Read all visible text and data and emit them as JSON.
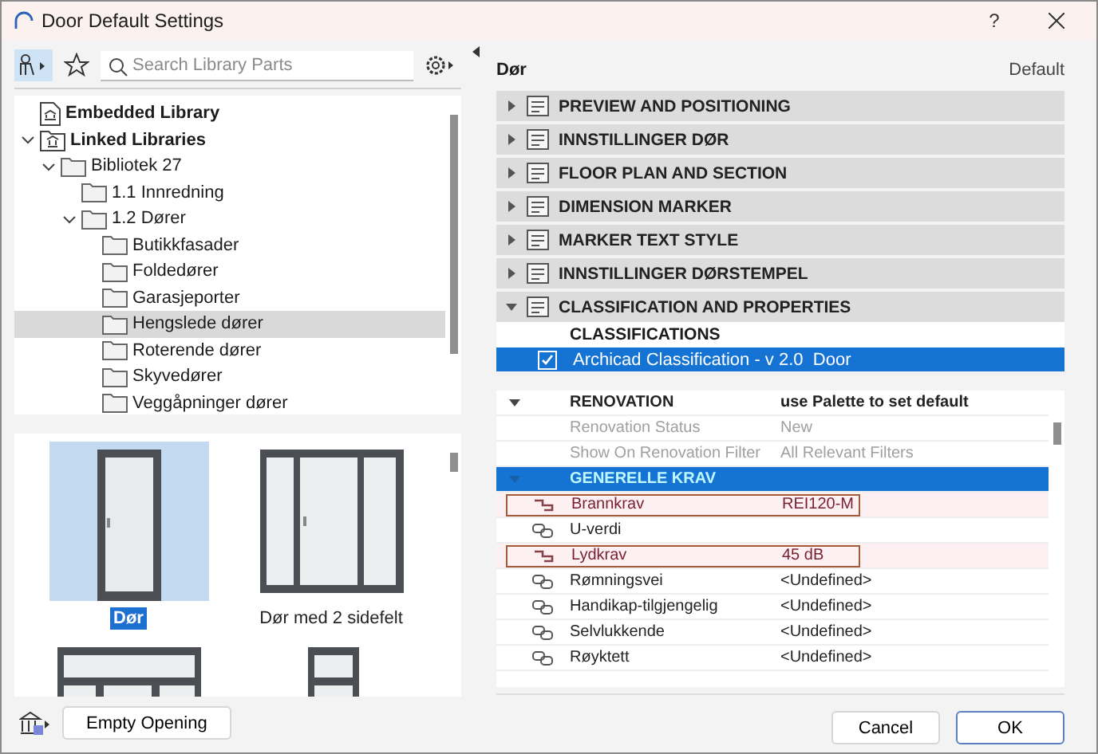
{
  "window": {
    "title": "Door Default Settings",
    "help": "?"
  },
  "library": {
    "search": {
      "placeholder": "Search Library Parts"
    },
    "tree": [
      {
        "label": "Embedded Library",
        "kind": "embedded",
        "bold": true,
        "selected": false
      },
      {
        "label": "Linked Libraries",
        "kind": "library",
        "bold": true,
        "expanded": true,
        "selected": false,
        "children": [
          {
            "label": "Bibliotek 27",
            "kind": "folder",
            "bold": false,
            "expanded": true,
            "selected": false,
            "children": [
              {
                "label": "1.1 Innredning",
                "kind": "folder",
                "bold": false,
                "selected": false
              },
              {
                "label": "1.2 Dører",
                "kind": "folder",
                "bold": false,
                "expanded": true,
                "selected": false,
                "children": [
                  {
                    "label": "Butikkfasader",
                    "kind": "folder",
                    "bold": false,
                    "selected": false
                  },
                  {
                    "label": "Foldedører",
                    "kind": "folder",
                    "bold": false,
                    "selected": false
                  },
                  {
                    "label": "Garasjeporter",
                    "kind": "folder",
                    "bold": false,
                    "selected": false
                  },
                  {
                    "label": "Hengslede dører",
                    "kind": "folder",
                    "bold": false,
                    "selected": true
                  },
                  {
                    "label": "Roterende dører",
                    "kind": "folder",
                    "bold": false,
                    "selected": false
                  },
                  {
                    "label": "Skyvedører",
                    "kind": "folder",
                    "bold": false,
                    "selected": false
                  },
                  {
                    "label": "Veggåpninger dører",
                    "kind": "folder",
                    "bold": false,
                    "selected": false
                  }
                ]
              }
            ]
          }
        ]
      }
    ],
    "thumbnails": [
      {
        "label": "Dør",
        "kind": "single",
        "selected": true
      },
      {
        "label": "Dør med 2 sidefelt",
        "kind": "sidelights",
        "selected": false
      },
      {
        "kind": "wide-transom",
        "selected": false
      },
      {
        "kind": "narrow-transom",
        "selected": false
      }
    ],
    "empty_opening": "Empty Opening"
  },
  "settings": {
    "element": "Dør",
    "preset": "Default",
    "sections": [
      {
        "title": "PREVIEW AND POSITIONING",
        "expanded": false
      },
      {
        "title": "INNSTILLINGER DØR",
        "expanded": false
      },
      {
        "title": "FLOOR PLAN AND SECTION",
        "expanded": false
      },
      {
        "title": "DIMENSION MARKER",
        "expanded": false
      },
      {
        "title": "MARKER TEXT STYLE",
        "expanded": false
      },
      {
        "title": "INNSTILLINGER DØRSTEMPEL",
        "expanded": false
      },
      {
        "title": "CLASSIFICATION AND PROPERTIES",
        "expanded": true
      }
    ],
    "classifications": {
      "header": "CLASSIFICATIONS",
      "rows": [
        {
          "label": "Archicad Classification - v 2.0  Door",
          "checked": true,
          "selected": true
        }
      ]
    },
    "properties": [
      {
        "kind": "group",
        "name": "RENOVATION",
        "value": "use Palette to set default",
        "expanded": true,
        "selected": false
      },
      {
        "kind": "plain",
        "name": "Renovation Status",
        "value": "New",
        "disabled": true,
        "flagged": false
      },
      {
        "kind": "plain",
        "name": "Show On Renovation Filter",
        "value": "All Relevant Filters",
        "disabled": true,
        "flagged": false
      },
      {
        "kind": "group",
        "name": "GENERELLE KRAV",
        "expanded": true,
        "selected": true
      },
      {
        "kind": "expression",
        "name": "Brannkrav",
        "value": "REI120-M",
        "disabled": false,
        "flagged": true
      },
      {
        "kind": "linked",
        "name": "U-verdi",
        "disabled": false,
        "flagged": false
      },
      {
        "kind": "expression",
        "name": "Lydkrav",
        "value": "45 dB",
        "disabled": false,
        "flagged": true
      },
      {
        "kind": "linked",
        "name": "Rømningsvei",
        "value": "<Undefined>",
        "disabled": false,
        "flagged": false
      },
      {
        "kind": "linked",
        "name": "Handikap-tilgjengelig",
        "value": "<Undefined>",
        "disabled": false,
        "flagged": false
      },
      {
        "kind": "linked",
        "name": "Selvlukkende",
        "value": "<Undefined>",
        "disabled": false,
        "flagged": false
      },
      {
        "kind": "linked",
        "name": "Røyktett",
        "value": "<Undefined>",
        "disabled": false,
        "flagged": false
      }
    ]
  },
  "buttons": [
    {
      "label": "Cancel",
      "default": false
    },
    {
      "label": "OK",
      "default": true
    }
  ]
}
